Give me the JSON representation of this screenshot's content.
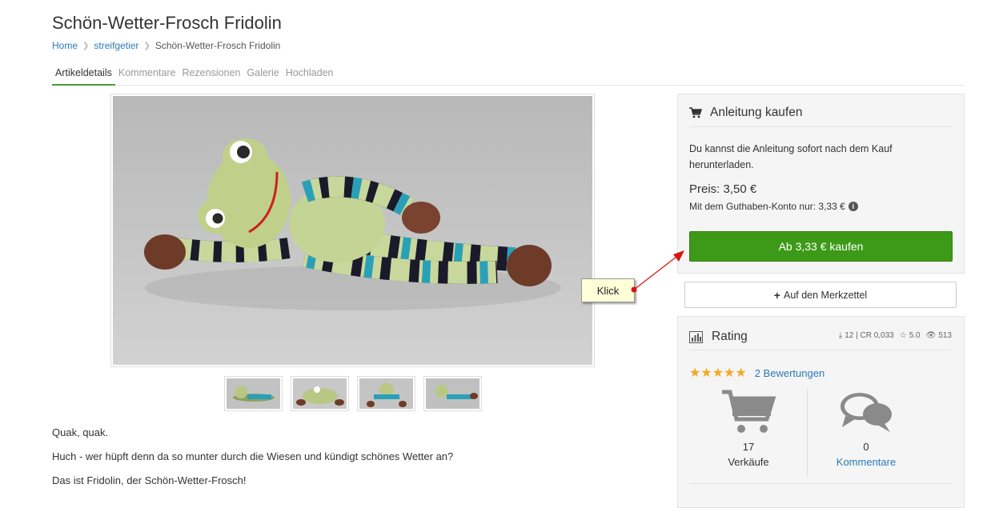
{
  "page": {
    "title": "Schön-Wetter-Frosch Fridolin"
  },
  "breadcrumb": [
    {
      "label": "Home"
    },
    {
      "label": "streifgetier"
    },
    {
      "label": "Schön-Wetter-Frosch Fridolin"
    }
  ],
  "tabs": [
    {
      "label": "Artikeldetails",
      "active": true
    },
    {
      "label": "Kommentare"
    },
    {
      "label": "Rezensionen"
    },
    {
      "label": "Galerie"
    },
    {
      "label": "Hochladen"
    }
  ],
  "description": [
    "Quak, quak.",
    "Huch - wer hüpft denn da so munter durch die Wiesen und kündigt schönes Wetter an?",
    "Das ist Fridolin, der Schön-Wetter-Frosch!"
  ],
  "buy_box": {
    "heading": "Anleitung kaufen",
    "heading_icon": "shopping-cart-icon",
    "text": "Du kannst die Anleitung sofort nach dem Kauf herunterladen.",
    "price": "Preis: 3,50 €",
    "guthaben": "Mit dem Guthaben-Konto nur: 3,33 €",
    "info_icon": "info-icon",
    "buy_button": "Ab 3,33 € kaufen",
    "accent_color": "#3d9a18"
  },
  "wishlist_button": "Auf den Merkzettel",
  "rating": {
    "heading": "Rating",
    "heading_icon": "bar-chart-icon",
    "downloads": "12 | CR 0,033",
    "stars_value": "5.0",
    "views": "513",
    "star_count": 5,
    "reviews_link": "2 Bewertungen",
    "sales_count": "17",
    "sales_label": "Verkäufe",
    "comments_count": "0",
    "comments_label": "Kommentare"
  },
  "callout": {
    "label": "Klick",
    "arrow_color": "#dd1111"
  }
}
